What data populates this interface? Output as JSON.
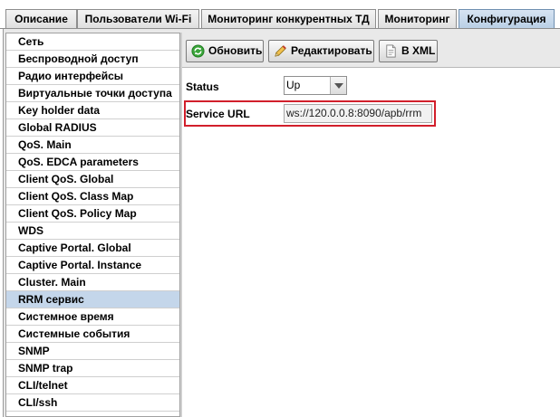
{
  "tabs": [
    {
      "label": "Описание"
    },
    {
      "label": "Пользователи Wi-Fi"
    },
    {
      "label": "Мониторинг конкурентных ТД"
    },
    {
      "label": "Мониторинг"
    },
    {
      "label": "Конфигурация",
      "active": true
    }
  ],
  "sidebar": {
    "selected": "RRM сервис",
    "items": [
      {
        "label": "Сеть"
      },
      {
        "label": "Беспроводной доступ"
      },
      {
        "label": "Радио интерфейсы"
      },
      {
        "label": "Виртуальные точки доступа"
      },
      {
        "label": "Key holder data"
      },
      {
        "label": "Global RADIUS"
      },
      {
        "label": "QoS. Main"
      },
      {
        "label": "QoS. EDCA parameters"
      },
      {
        "label": "Client QoS. Global"
      },
      {
        "label": "Client QoS. Class Map"
      },
      {
        "label": "Client QoS. Policy Map"
      },
      {
        "label": "WDS"
      },
      {
        "label": "Captive Portal. Global"
      },
      {
        "label": "Captive Portal. Instance"
      },
      {
        "label": "Cluster. Main"
      },
      {
        "label": "RRM сервис"
      },
      {
        "label": "Системное время"
      },
      {
        "label": "Системные события"
      },
      {
        "label": "SNMP"
      },
      {
        "label": "SNMP trap"
      },
      {
        "label": "CLI/telnet"
      },
      {
        "label": "CLI/ssh"
      }
    ]
  },
  "toolbar": {
    "refresh_label": "Обновить",
    "edit_label": "Редактировать",
    "xml_label": "В XML"
  },
  "form": {
    "status_label": "Status",
    "status_value": "Up",
    "service_url_label": "Service URL",
    "service_url_value": "ws://120.0.0.8:8090/apb/rrm"
  },
  "icons": {
    "refresh": "refresh-icon",
    "edit": "pencil-icon",
    "xml": "document-icon",
    "dropdown": "chevron-down-icon"
  },
  "colors": {
    "selected_row": "#c4d6ea",
    "active_tab": "#b8cfe5",
    "highlight_border": "#d21f2b"
  }
}
